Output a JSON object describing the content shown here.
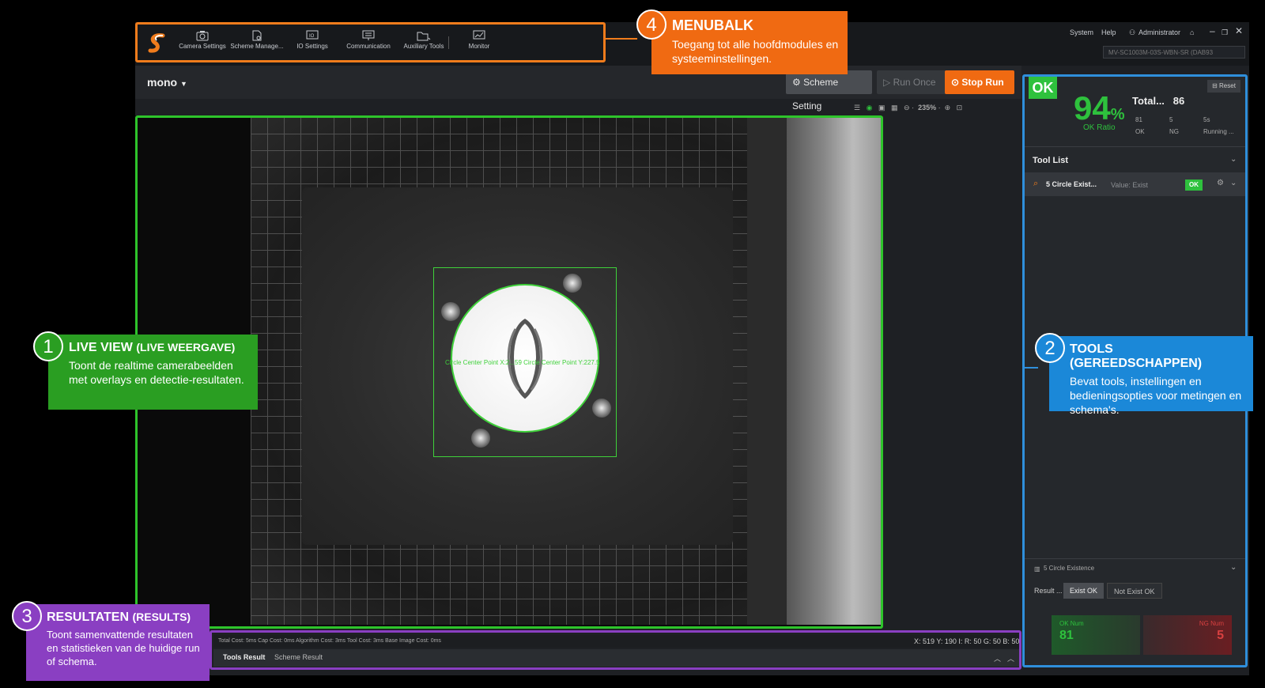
{
  "menu": {
    "items": [
      {
        "label": "Camera Settings",
        "icon": "camera-icon"
      },
      {
        "label": "Scheme Manage...",
        "icon": "document-gear-icon"
      },
      {
        "label": "IO Settings",
        "icon": "io-icon"
      },
      {
        "label": "Communication",
        "icon": "monitor-network-icon"
      },
      {
        "label": "Auxiliary Tools",
        "icon": "folder-tools-icon"
      },
      {
        "label": "Monitor",
        "icon": "chart-icon"
      }
    ]
  },
  "system": {
    "system": "System",
    "help": "Help",
    "user": "Administrator",
    "device": "MV-SC1003M-03S-WBN-SR (DAB93"
  },
  "scheme": {
    "name": "mono",
    "scheme_setting": "Scheme Setting",
    "run_once": "Run Once",
    "stop_run": "Stop Run"
  },
  "toolbar": {
    "zoom": "235%"
  },
  "viewer": {
    "overlay": "Circle Center Point X:2...59 Circle Center Point Y:227.5"
  },
  "panel": {
    "ok": "OK",
    "reset": "Reset",
    "ratio": "94",
    "ratio_unit": "%",
    "ratio_label": "OK Ratio",
    "total_label": "Total...",
    "total": "86",
    "ok_count": "81",
    "ok_label": "OK",
    "ng_count": "5",
    "ng_label": "NG",
    "running_time": "5s",
    "running_label": "Running ...",
    "tool_list": "Tool List",
    "tool_name": "5 Circle Exist...",
    "tool_value": "Value: Exist",
    "tool_status": "OK",
    "detail_title": "5 Circle Existence",
    "result_label": "Result ...",
    "exist_ok": "Exist OK",
    "not_exist_ok": "Not Exist OK",
    "ok_num_label": "OK Num",
    "ok_num": "81",
    "ng_num_label": "NG Num",
    "ng_num": "5"
  },
  "results": {
    "cost": "Total Cost: 5ms Cap Cost: 0ms Algorithm Cost: 3ms Tool Cost: 3ms Base Image Cost: 0ms",
    "coord": "X: 519 Y: 190 I: R: 50 G: 50 B: 50",
    "tab1": "Tools Result",
    "tab2": "Scheme Result"
  },
  "callouts": {
    "menubalk": {
      "num": "4",
      "title": "MENUBALK",
      "desc": "Toegang tot alle hoofdmodules en systeeminstellingen."
    },
    "live": {
      "num": "1",
      "title": "LIVE VIEW",
      "title_sub": "(LIVE WEERGAVE)",
      "desc": "Toont de realtime camerabeelden met overlays en detectie-resultaten."
    },
    "tools": {
      "num": "2",
      "title": "TOOLS (GEREEDSCHAPPEN)",
      "desc": "Bevat tools, instellingen en bedieningsopties voor metingen en schema's."
    },
    "results": {
      "num": "3",
      "title": "RESULTATEN",
      "title_sub": "(RESULTS)",
      "desc": "Toont samenvattende resultaten en statistieken van de huidige run of schema."
    }
  },
  "colors": {
    "orange": "#f07c1c",
    "green": "#2ec42b",
    "blue": "#2f8fdb",
    "purple": "#8a3fc2"
  }
}
